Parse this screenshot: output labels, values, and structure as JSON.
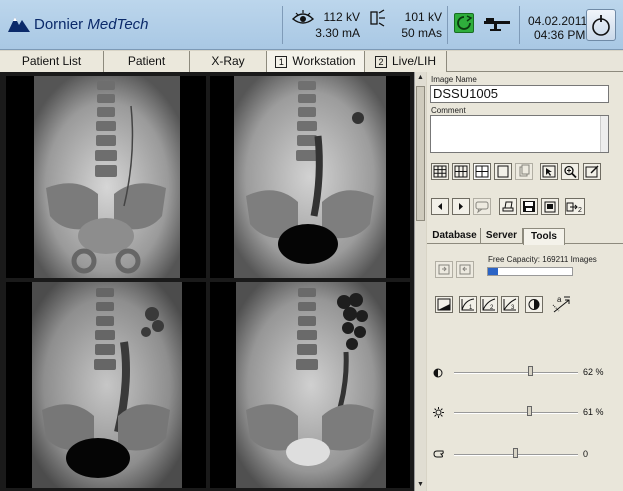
{
  "header": {
    "brand_first": "Dornier",
    "brand_second": "MedTech",
    "fluoro_kv": "112 kV",
    "fluoro_ma": "3.30 mA",
    "exposure_kv": "101 kV",
    "exposure_mas": "50 mAs",
    "date": "04.02.2011",
    "time": "04:36 PM",
    "icons": [
      "dornier-logo-icon",
      "eye-icon",
      "exposure-icon",
      "status-ok-icon",
      "patient-table-icon",
      "power-icon"
    ],
    "status_color": "#2fae3c"
  },
  "tabs": [
    {
      "label": "Patient List"
    },
    {
      "label": "Patient"
    },
    {
      "label": "X-Ray"
    },
    {
      "num": "1",
      "label": "Workstation"
    },
    {
      "num": "2",
      "label": "Live/LIH"
    }
  ],
  "active_tab": "Workstation",
  "panel": {
    "image_name_label": "Image Name",
    "image_name_value": "DSSU1005",
    "comment_label": "Comment",
    "comment_value": "",
    "tabs": [
      "Database",
      "Server",
      "Tools"
    ],
    "active_tab": "Tools",
    "capacity_text": "Free Capacity: 169211 Images",
    "capacity_fraction": 0.12,
    "sliders": [
      {
        "name": "contrast",
        "icon": "contrast-icon",
        "value_text": "62 %",
        "value": 62
      },
      {
        "name": "brightness",
        "icon": "brightness-icon",
        "value_text": "61 %",
        "value": 61
      },
      {
        "name": "edge",
        "icon": "edge-enhance-icon",
        "value_text": "0",
        "value": 50
      }
    ]
  }
}
